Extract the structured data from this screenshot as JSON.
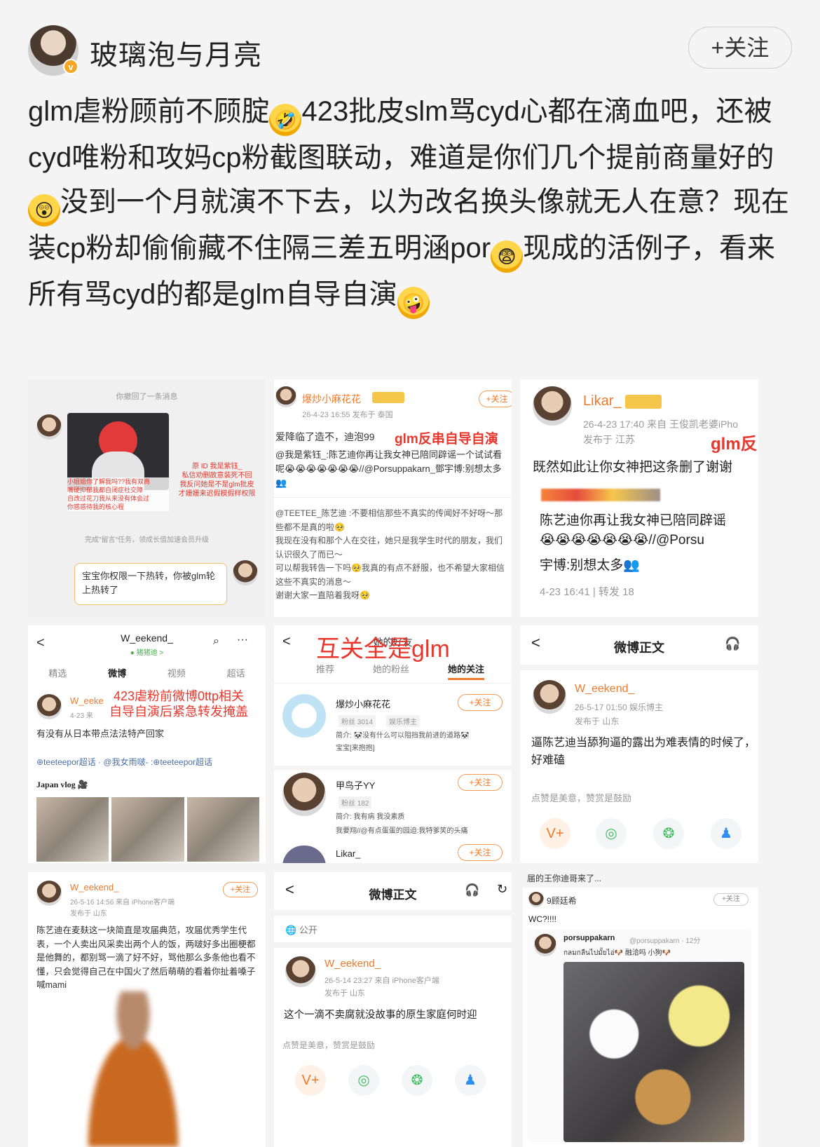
{
  "header": {
    "username": "玻璃泡与月亮",
    "follow_label": "+关注",
    "verified_badge": "v"
  },
  "post": {
    "seg1": "glm虐粉顾前不顾腚",
    "emoji1": "🤣",
    "seg2": "423批皮slm骂cyd心都在滴血吧，还被cyd唯粉和攻妈cp粉截图联动，难道是你们几个提前商量好的",
    "emoji2": "😲",
    "seg3": "没到一个月就演不下去，以为改名换头像就无人在意？现在装cp粉却偷偷藏不住隔三差五明涵por",
    "emoji3": "😨",
    "seg4": "现成的活例子，看来所有骂cyd的都是glm自导自演",
    "emoji4": "🤪"
  },
  "images": {
    "img1": {
      "top_text": "你撤回了一条消息",
      "red_lines": [
        "原 ID 我是紫钰_",
        "私信劝删故意装死不回",
        "我反问她是不是glm批皮",
        "才姗姗来迟假模假样权限"
      ],
      "left_red": [
        "小姐姐你了解我吗??我有双商",
        "嘴硬抑郁我都自闭症社交障",
        "自改过花刀我从来没有体会过",
        "你惑惑待我的核心程"
      ],
      "task_text": "完成\"留言\"任务，领成长值加速会员升级",
      "task_link": "领成长值",
      "bubble_text": "宝宝你权限一下热转，你被glm轮上热转了"
    },
    "img2": {
      "name": "爆炒小麻花花",
      "meta": "26-4-23 16:55  发布于 泰国",
      "follow": "+关注",
      "line1": "爱降临了造不，迪泡99",
      "red_overlay": "glm反串自导自演",
      "line2": "@我是紫钰_:陈艺迪你再让我女神已陪同辟谣一个试试看呢😭😭😭😭😭😭😭//@Porsuppakarn_鄧宇博:别想太多👥",
      "line3": "@TEETEE_陈艺迪 :不要相信那些不真实的传闻好不好呀～那些都不是真的啦🥺",
      "line4": "我现在没有和那个人在交往，她只是我学生时代的朋友，我们认识很久了而已～",
      "line5": "可以帮我转告一下吗🥺我真的有点不舒服，也不希望大家相信这些不真实的消息～",
      "line6": "谢谢大家一直陪着我呀🥺"
    },
    "img3": {
      "name": "Likar_",
      "meta1": "26-4-23 17:40  来自 王俊凯老婆iPho",
      "meta2": "发布于 江苏",
      "red_overlay": "glm反",
      "line1": "既然如此让你女神把这条删了谢谢",
      "line2": "陈艺迪你再让我女神已陪同辟谣",
      "line3": "😭😭😭😭😭😭😭//@Porsu",
      "line4": "宇博:别想太多👥",
      "footer": "4-23 16:41 | 转发 18"
    },
    "img4": {
      "title": "W_eekend_",
      "subtitle": "● 猪猪迪 >",
      "tabs": [
        "精选",
        "微博",
        "视频",
        "超话"
      ],
      "red_overlay": "423虐粉前微博0ttp相关\n自导自演后紧急转发掩盖",
      "name": "W_eeke",
      "meta": "4-23  来",
      "line1": "有没有从日本带点法法特产回家",
      "tags": "⊕teeteepor超话 · @我女雨啵- :⊕teeteepor超话",
      "vlog": "Japan vlog 🎥"
    },
    "img5": {
      "red_overlay": "互关全是glm",
      "title_behind": "她的好友",
      "tabs": [
        "推荐",
        "她的粉丝",
        "她的关注"
      ],
      "users": [
        {
          "name": "爆炒小麻花花",
          "fans": "粉丝 3014",
          "tag": "娱乐博主",
          "bio": "简介: 🐼没有什么可以阻挡我前进的道路🐼",
          "bio2": "宝宝[来抱抱]",
          "follow": "+关注"
        },
        {
          "name": "甲鸟子YY",
          "fans": "粉丝 182",
          "tag": "",
          "bio": "简介: 我有病 我没素质",
          "bio2": "我要翔//@有点蛋蛋的园迫:我特爹笑的头痛",
          "follow": "+关注"
        },
        {
          "name": "Likar_",
          "fans": "",
          "tag": "",
          "bio": "",
          "bio2": "",
          "follow": "+关注"
        }
      ]
    },
    "img6": {
      "title": "微博正文",
      "name": "W_eekend_",
      "meta1": "26-5-17 01:50  娱乐博主",
      "meta2": "发布于 山东",
      "line1": "逼陈艺迪当舔狗逼的露出为难表情的时候了，好难磕",
      "reward": "点赞是美意，赞赏是鼓励"
    },
    "img7": {
      "name": "W_eekend_",
      "meta1": "26-5-16 14:56  来自 iPhone客户端",
      "meta2": "发布于 山东",
      "follow": "+关注",
      "body": "陈艺迪在麦麸这一块简直是攻届典范，攻届优秀学生代表，一个人卖出风采卖出两个人的饭，两啵好多出圈梗都是他舞的，都别骂一滴了好不好，骂他那么多条他也看不懂，只会觉得自己在中国火了然后萌萌的看着你扯着嗓子喊mami"
    },
    "img8": {
      "title": "微博正文",
      "public": "公开",
      "name": "W_eekend_",
      "meta1": "26-5-14 23:27  来自 iPhone客户端",
      "meta2": "发布于 山东",
      "line1": "这个一滴不卖腐就没故事的原生家庭何时迎",
      "reward": "点赞是美意，赞赏是鼓励"
    },
    "img9": {
      "top": "届的王你迪哥来了...",
      "name": "9顾廷希",
      "follow": "+关注",
      "line1": "WC?!!!!",
      "inner_name": "porsuppakarn",
      "inner_handle": "@porsuppakarn · 12分",
      "inner_text": "กลมกลืนไปมั้ยไอ่🐶  融洽吗 小狗🐶"
    }
  },
  "colors": {
    "accent_orange": "#f07a2c",
    "overlay_red": "#e8372c",
    "gold_badge": "#f5a623"
  }
}
